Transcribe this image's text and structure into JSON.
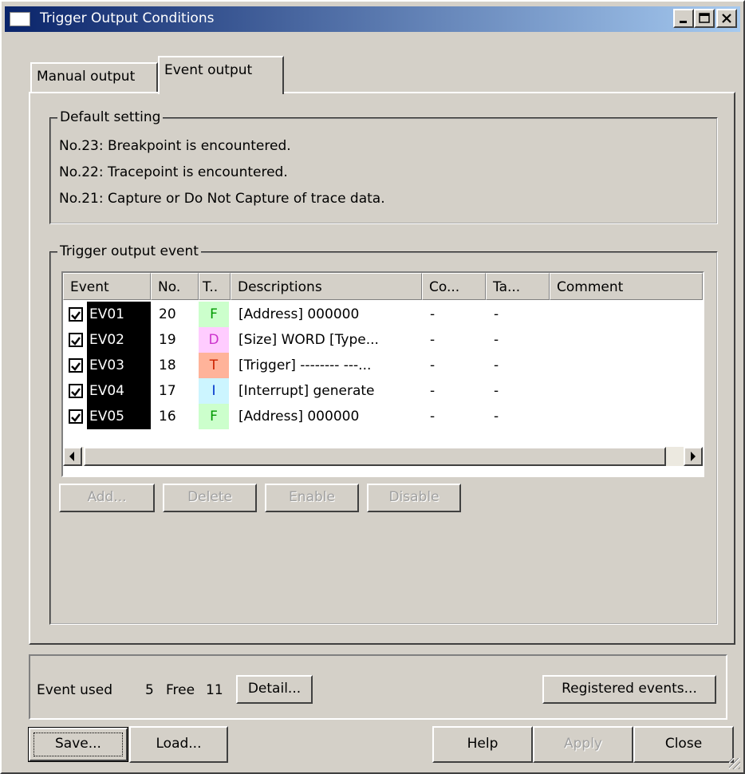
{
  "window": {
    "title": "Trigger Output Conditions"
  },
  "tabs": [
    {
      "label": "Manual output",
      "active": false
    },
    {
      "label": "Event output",
      "active": true
    }
  ],
  "default_setting": {
    "legend": "Default setting",
    "lines": [
      "No.23: Breakpoint is encountered.",
      "No.22: Tracepoint is encountered.",
      "No.21: Capture or Do Not Capture of trace data."
    ]
  },
  "trigger_output_event": {
    "legend": "Trigger output event",
    "columns": [
      "Event",
      "No.",
      "T..",
      "Descriptions",
      "Co...",
      "Ta...",
      "Comment"
    ],
    "rows": [
      {
        "checked": true,
        "event": "EV01",
        "no": "20",
        "type": "F",
        "type_color": "#ccffcc",
        "type_text_color": "#009900",
        "description": "[Address] 000000",
        "co": "-",
        "ta": "-",
        "comment": ""
      },
      {
        "checked": true,
        "event": "EV02",
        "no": "19",
        "type": "D",
        "type_color": "#ffccff",
        "type_text_color": "#cc33cc",
        "description": "[Size] WORD  [Type...",
        "co": "-",
        "ta": "-",
        "comment": ""
      },
      {
        "checked": true,
        "event": "EV03",
        "no": "18",
        "type": "T",
        "type_color": "#ffb39a",
        "type_text_color": "#cc2200",
        "description": "[Trigger]  -------- ---...",
        "co": "-",
        "ta": "-",
        "comment": ""
      },
      {
        "checked": true,
        "event": "EV04",
        "no": "17",
        "type": "I",
        "type_color": "#ccf5ff",
        "type_text_color": "#0033cc",
        "description": "[Interrupt] generate",
        "co": "-",
        "ta": "-",
        "comment": ""
      },
      {
        "checked": true,
        "event": "EV05",
        "no": "16",
        "type": "F",
        "type_color": "#ccffcc",
        "type_text_color": "#009900",
        "description": "[Address] 000000",
        "co": "-",
        "ta": "-",
        "comment": ""
      }
    ],
    "buttons": {
      "add": "Add...",
      "delete": "Delete",
      "enable": "Enable",
      "disable": "Disable"
    }
  },
  "status": {
    "event_used_label": "Event used",
    "event_used": "5",
    "free_label": "Free",
    "free": "11",
    "detail_button": "Detail...",
    "registered_button": "Registered events..."
  },
  "footer": {
    "save": "Save...",
    "load": "Load...",
    "help": "Help",
    "apply": "Apply",
    "close": "Close"
  },
  "icons": {
    "app": "window-icon",
    "minimize": "minimize-icon",
    "maximize": "maximize-icon",
    "close": "close-icon",
    "check": "checkbox-checked-icon",
    "left": "scroll-left-icon",
    "right": "scroll-right-icon",
    "grip": "resize-grip-icon"
  },
  "colors": {
    "titlebar_start": "#0a246a",
    "titlebar_end": "#a6caf0",
    "face": "#d4d0c8"
  }
}
